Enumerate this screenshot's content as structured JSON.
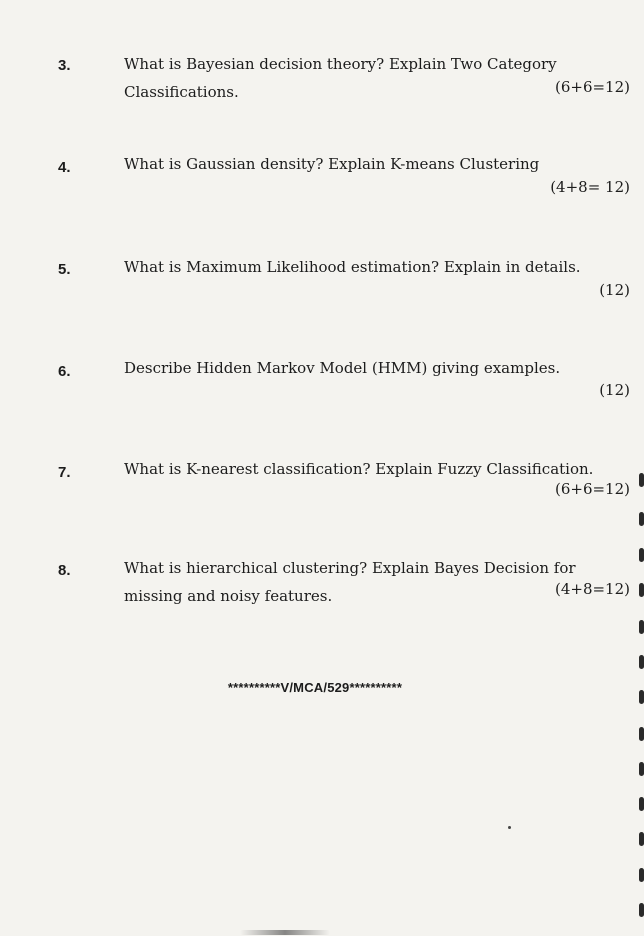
{
  "questions": [
    {
      "number": "3.",
      "line1": "What is Bayesian decision theory?  Explain Two Category",
      "line2": "Classifications.",
      "marks": "(6+6=12)"
    },
    {
      "number": "4.",
      "line1": "What is Gaussian density? Explain K-means Clustering",
      "line2": "",
      "marks": "(4+8= 12)"
    },
    {
      "number": "5.",
      "line1": "What is Maximum Likelihood estimation? Explain in details.",
      "line2": "",
      "marks": "(12)"
    },
    {
      "number": "6.",
      "line1": "Describe Hidden Markov Model (HMM) giving examples.",
      "line2": "",
      "marks": "(12)"
    },
    {
      "number": "7.",
      "line1": "What is K-nearest classification? Explain Fuzzy Classification.",
      "line2": "",
      "marks": "(6+6=12)"
    },
    {
      "number": "8.",
      "line1": "What is hierarchical clustering? Explain Bayes Decision for",
      "line2": "missing and noisy features.",
      "marks": "(4+8=12)"
    }
  ],
  "footer": "**********V/MCA/529**********"
}
